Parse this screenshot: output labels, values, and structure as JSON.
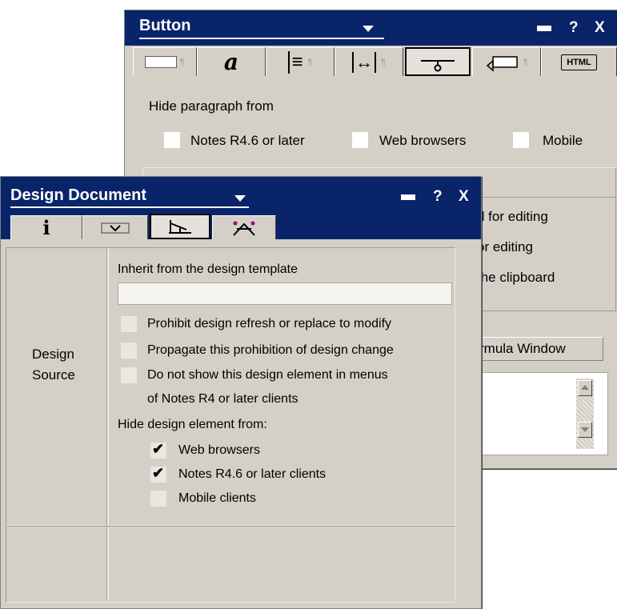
{
  "button_window": {
    "title": "Button",
    "title_buttons": {
      "help": "?",
      "close": "X"
    },
    "tabs": [
      {
        "name": "field-tab",
        "icon": "field-icon",
        "selected": false
      },
      {
        "name": "font-tab",
        "icon": "font-icon",
        "glyph": "a",
        "selected": false
      },
      {
        "name": "alignment-tab",
        "icon": "alignment-icon",
        "glyph": "≡",
        "selected": false
      },
      {
        "name": "margins-tab",
        "icon": "margins-icon",
        "glyph": "↔",
        "selected": false
      },
      {
        "name": "hide-when-tab",
        "icon": "hide-when-icon",
        "selected": true
      },
      {
        "name": "hotspot-tab",
        "icon": "hotspot-icon",
        "selected": false
      },
      {
        "name": "html-tab",
        "icon": "html-icon",
        "glyph": "HTML",
        "selected": false
      }
    ],
    "hide_paragraph_label": "Hide paragraph from",
    "hide_options": [
      {
        "label": "Notes R4.6 or later",
        "checked": false
      },
      {
        "label": "Web browsers",
        "checked": false
      },
      {
        "label": "Mobile",
        "checked": false
      }
    ],
    "partial_options": [
      "d for editing",
      "or editing",
      "the clipboard"
    ],
    "formula_window_button": "rmula Window"
  },
  "design_window": {
    "title": "Design Document",
    "title_buttons": {
      "help": "?",
      "close": "X"
    },
    "tabs": [
      {
        "name": "info-tab",
        "icon": "info-icon",
        "glyph": "i",
        "selected": false
      },
      {
        "name": "fields-tab",
        "icon": "fields-icon",
        "selected": false
      },
      {
        "name": "design-tab",
        "icon": "design-icon",
        "selected": true
      },
      {
        "name": "security-tab",
        "icon": "security-icon",
        "selected": false
      }
    ],
    "section_label_line1": "Design",
    "section_label_line2": "Source",
    "inherit_label": "Inherit from the design template",
    "inherit_value": "",
    "options": [
      {
        "label": "Prohibit design refresh or replace to modify",
        "checked": false
      },
      {
        "label": "Propagate this prohibition of design change",
        "checked": false
      },
      {
        "label": "Do not show this design element in menus",
        "checked": false
      }
    ],
    "option3_continued": "of Notes R4 or later clients",
    "hide_design_label": "Hide design element from:",
    "hide_design_options": [
      {
        "label": "Web browsers",
        "checked": true
      },
      {
        "label": "Notes R4.6 or later clients",
        "checked": true
      },
      {
        "label": "Mobile clients",
        "checked": false
      }
    ]
  },
  "colors": {
    "titlebar": "#0a246a",
    "face": "#d4d0c8"
  }
}
